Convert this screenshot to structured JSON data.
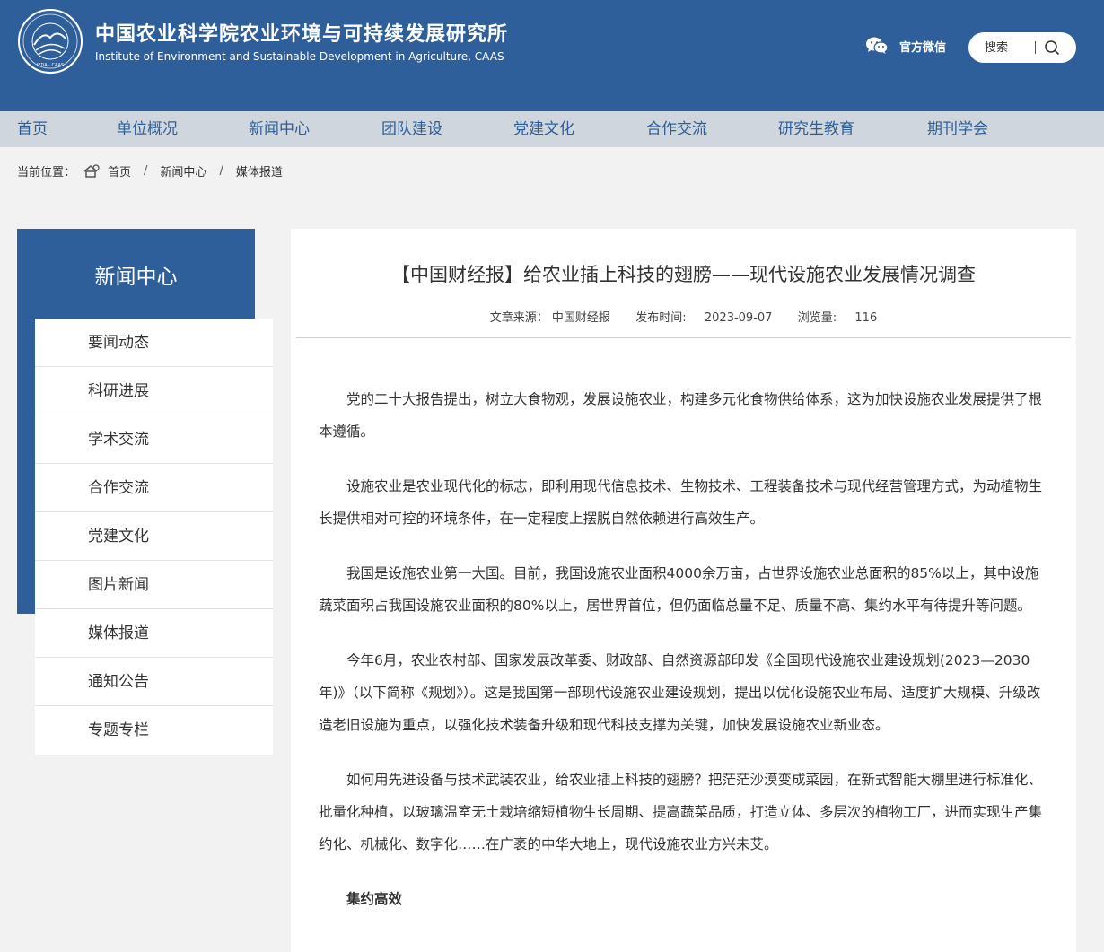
{
  "header": {
    "site_title_cn": "中国农业科学院农业环境与可持续发展研究所",
    "site_title_en": "Institute of Environment and Sustainable Development in Agriculture, CAAS",
    "logo_text": "IEDA · CAAS",
    "wechat_label": "官方微信",
    "search_placeholder": "搜索",
    "brand_color": "#2e5f9a"
  },
  "nav": {
    "items": [
      "首页",
      "单位概况",
      "新闻中心",
      "团队建设",
      "党建文化",
      "合作交流",
      "研究生教育",
      "期刊学会"
    ]
  },
  "breadcrumb": {
    "label": "当前位置：",
    "items": [
      "首页",
      "新闻中心",
      "媒体报道"
    ],
    "separator": "/"
  },
  "sidebar": {
    "title": "新闻中心",
    "items": [
      "要闻动态",
      "科研进展",
      "学术交流",
      "合作交流",
      "党建文化",
      "图片新闻",
      "媒体报道",
      "通知公告",
      "专题专栏"
    ]
  },
  "article": {
    "title": "【中国财经报】给农业插上科技的翅膀——现代设施农业发展情况调查",
    "source_label": "文章来源：",
    "source": "中国财经报",
    "date_label": "发布时间:",
    "date": "2023-09-07",
    "views_label": "浏览量:",
    "views": "116",
    "paragraphs": [
      "党的二十大报告提出，树立大食物观，发展设施农业，构建多元化食物供给体系，这为加快设施农业发展提供了根本遵循。",
      "设施农业是农业现代化的标志，即利用现代信息技术、生物技术、工程装备技术与现代经营管理方式，为动植物生长提供相对可控的环境条件，在一定程度上摆脱自然依赖进行高效生产。",
      "我国是设施农业第一大国。目前，我国设施农业面积4000余万亩，占世界设施农业总面积的85%以上，其中设施蔬菜面积占我国设施农业面积的80%以上，居世界首位，但仍面临总量不足、质量不高、集约水平有待提升等问题。",
      "今年6月，农业农村部、国家发展改革委、财政部、自然资源部印发《全国现代设施农业建设规划(2023—2030年)》（以下简称《规划》）。这是我国第一部现代设施农业建设规划，提出以优化设施农业布局、适度扩大规模、升级改造老旧设施为重点，以强化技术装备升级和现代科技支撑为关键，加快发展设施农业新业态。",
      "如何用先进设备与技术武装农业，给农业插上科技的翅膀？把茫茫沙漠变成菜园，在新式智能大棚里进行标准化、批量化种植，以玻璃温室无土栽培缩短植物生长周期、提高蔬菜品质，打造立体、多层次的植物工厂，进而实现生产集约化、机械化、数字化……在广袤的中华大地上，现代设施农业方兴未艾。"
    ],
    "subheading": "集约高效"
  }
}
